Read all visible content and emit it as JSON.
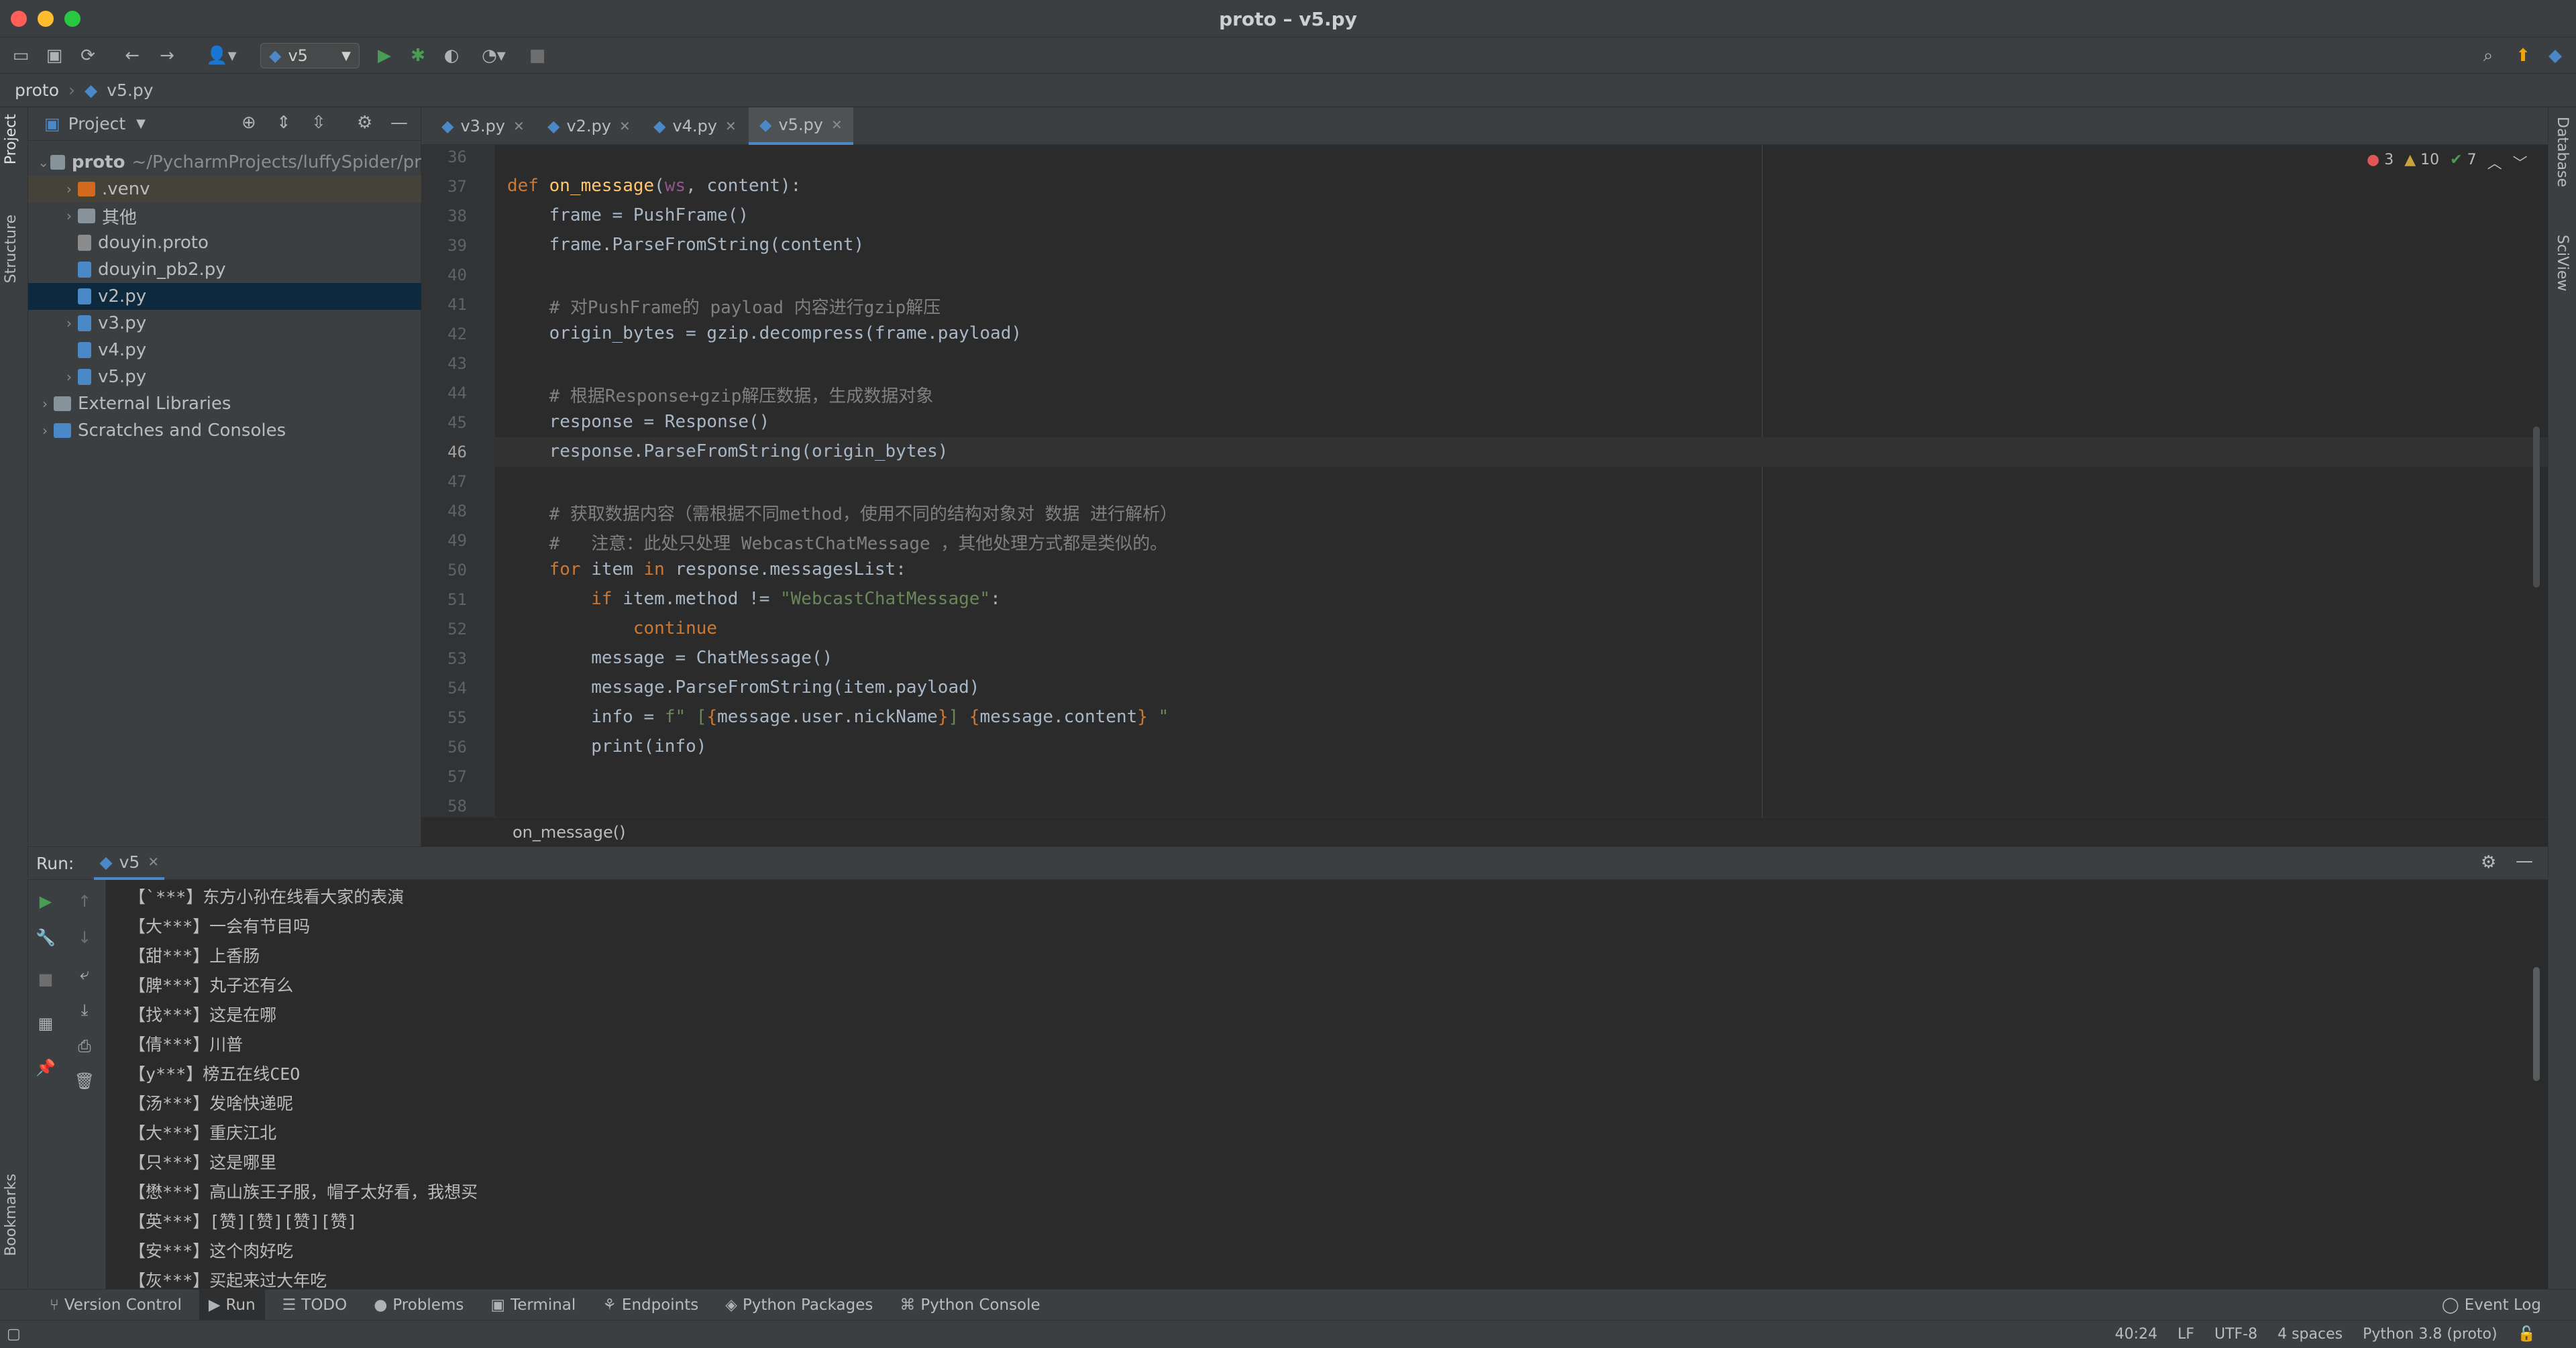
{
  "window": {
    "title": "proto – v5.py"
  },
  "toolbar": {
    "run_config": "v5"
  },
  "breadcrumb": [
    "proto",
    "v5.py"
  ],
  "left_strip": {
    "project": "Project",
    "structure": "Structure",
    "bookmarks": "Bookmarks"
  },
  "right_strip": {
    "database": "Database",
    "sciview": "SciView"
  },
  "project": {
    "header": "Project",
    "tree": [
      {
        "label": "proto",
        "suffix": "~/PycharmProjects/luffySpider/pr",
        "depth": 0,
        "chev": "v",
        "icon": "folder"
      },
      {
        "label": ".venv",
        "depth": 1,
        "chev": ">",
        "icon": "folder-orange"
      },
      {
        "label": "其他",
        "depth": 1,
        "chev": ">",
        "icon": "folder"
      },
      {
        "label": "douyin.proto",
        "depth": 1,
        "chev": "",
        "icon": "file"
      },
      {
        "label": "douyin_pb2.py",
        "depth": 1,
        "chev": "",
        "icon": "py"
      },
      {
        "label": "v2.py",
        "depth": 1,
        "chev": "",
        "icon": "py"
      },
      {
        "label": "v3.py",
        "depth": 1,
        "chev": ">",
        "icon": "py"
      },
      {
        "label": "v4.py",
        "depth": 1,
        "chev": "",
        "icon": "py"
      },
      {
        "label": "v5.py",
        "depth": 1,
        "chev": ">",
        "icon": "py"
      },
      {
        "label": "External Libraries",
        "depth": 0,
        "chev": ">",
        "icon": "lib"
      },
      {
        "label": "Scratches and Consoles",
        "depth": 0,
        "chev": ">",
        "icon": "scratch"
      }
    ]
  },
  "tabs": [
    {
      "label": "v3.py"
    },
    {
      "label": "v2.py"
    },
    {
      "label": "v4.py"
    },
    {
      "label": "v5.py",
      "active": true
    }
  ],
  "inspections": {
    "errors": "3",
    "warnings": "10",
    "ok": "7"
  },
  "editor": {
    "current_line": "46",
    "lines": [
      {
        "n": "36",
        "html": ""
      },
      {
        "n": "37",
        "html": "<span class='kw'>def</span> <span class='fn'>on_message</span>(<span class='param'>ws</span>, content):"
      },
      {
        "n": "38",
        "html": "    frame = PushFrame()"
      },
      {
        "n": "39",
        "html": "    frame.ParseFromString(content)"
      },
      {
        "n": "40",
        "html": ""
      },
      {
        "n": "41",
        "html": "    <span class='cm'># 对PushFrame的 payload 内容进行gzip解压</span>"
      },
      {
        "n": "42",
        "html": "    origin_bytes = gzip.decompress(frame.payload)"
      },
      {
        "n": "43",
        "html": ""
      },
      {
        "n": "44",
        "html": "    <span class='cm'># 根据Response+gzip解压数据，生成数据对象</span>"
      },
      {
        "n": "45",
        "html": "    response = Response()"
      },
      {
        "n": "46",
        "html": "    response.ParseFromString(origin_bytes)"
      },
      {
        "n": "47",
        "html": ""
      },
      {
        "n": "48",
        "html": "    <span class='cm'># 获取数据内容（需根据不同method，使用不同的结构对象对 数据 进行解析）</span>"
      },
      {
        "n": "49",
        "html": "    <span class='cm'>#   注意：此处只处理 WebcastChatMessage ，其他处理方式都是类似的。</span>"
      },
      {
        "n": "50",
        "html": "    <span class='kw'>for</span> item <span class='kw'>in</span> response.messagesList:"
      },
      {
        "n": "51",
        "html": "        <span class='kw'>if</span> item.method != <span class='str'>\"WebcastChatMessage\"</span>:"
      },
      {
        "n": "52",
        "html": "            <span class='kw'>continue</span>"
      },
      {
        "n": "53",
        "html": "        message = ChatMessage()"
      },
      {
        "n": "54",
        "html": "        message.ParseFromString(item.payload)"
      },
      {
        "n": "55",
        "html": "        info = <span class='str'>f\" [</span><span class='brk'>{</span>message.user.nickName<span class='brk'>}</span><span class='str'>] </span><span class='brk'>{</span>message.content<span class='brk'>}</span><span class='str'> \"</span>"
      },
      {
        "n": "56",
        "html": "        print(info)"
      },
      {
        "n": "57",
        "html": ""
      },
      {
        "n": "58",
        "html": ""
      }
    ]
  },
  "method_breadcrumb": "on_message()",
  "run": {
    "label": "Run:",
    "tab": "v5",
    "output": [
      "【`***】东方小孙在线看大家的表演",
      "【大***】一会有节目吗",
      "【甜***】上香肠",
      "【脾***】丸子还有么",
      "【找***】这是在哪",
      "【倩***】川普",
      "【y***】榜五在线CEO",
      "【汤***】发啥快递呢",
      "【大***】重庆江北",
      "【只***】这是哪里",
      "【懋***】高山族王子服，帽子太好看，我想买",
      "【英***】[赞][赞][赞][赞]",
      "【安***】这个肉好吃",
      "【灰***】买起来过大年吃"
    ]
  },
  "toolwindows": [
    {
      "label": "Version Control",
      "icon": "⑂"
    },
    {
      "label": "Run",
      "icon": "▶",
      "active": true
    },
    {
      "label": "TODO",
      "icon": "☰"
    },
    {
      "label": "Problems",
      "icon": "●"
    },
    {
      "label": "Terminal",
      "icon": "▣"
    },
    {
      "label": "Endpoints",
      "icon": "⚘"
    },
    {
      "label": "Python Packages",
      "icon": "◈"
    },
    {
      "label": "Python Console",
      "icon": "⌘"
    }
  ],
  "event_log": "Event Log",
  "status": {
    "position": "40:24",
    "line_sep": "LF",
    "encoding": "UTF-8",
    "indent": "4 spaces",
    "interpreter": "Python 3.8 (proto)"
  },
  "colors": {
    "accent": "#4a88c7",
    "run_green": "#499c54",
    "error": "#e05555",
    "warning": "#c9a33d"
  }
}
